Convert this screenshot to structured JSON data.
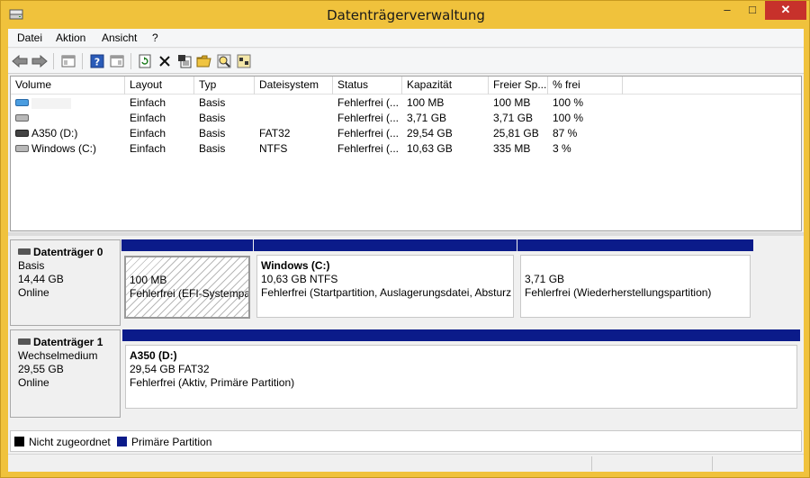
{
  "window": {
    "title": "Datenträgerverwaltung",
    "minimize": "–",
    "maximize": "□",
    "close": "✕"
  },
  "menu": [
    "Datei",
    "Aktion",
    "Ansicht",
    "?"
  ],
  "toolbar": [
    "back-arrow",
    "forward-arrow",
    "console-tree",
    "help",
    "properties-view",
    "refresh",
    "delete",
    "properties",
    "open",
    "explore",
    "rescan"
  ],
  "columns": [
    "Volume",
    "Layout",
    "Typ",
    "Dateisystem",
    "Status",
    "Kapazität",
    "Freier Sp...",
    "% frei"
  ],
  "volumes": [
    {
      "name": "",
      "layout": "Einfach",
      "type": "Basis",
      "fs": "",
      "status": "Fehlerfrei (...",
      "capacity": "100 MB",
      "free": "100 MB",
      "pct": "100 %",
      "icon": "volume-blue"
    },
    {
      "name": "",
      "layout": "Einfach",
      "type": "Basis",
      "fs": "",
      "status": "Fehlerfrei (...",
      "capacity": "3,71 GB",
      "free": "3,71 GB",
      "pct": "100 %",
      "icon": "volume-gray"
    },
    {
      "name": "A350 (D:)",
      "layout": "Einfach",
      "type": "Basis",
      "fs": "FAT32",
      "status": "Fehlerfrei (...",
      "capacity": "29,54 GB",
      "free": "25,81 GB",
      "pct": "87 %",
      "icon": "volume-dark"
    },
    {
      "name": "Windows (C:)",
      "layout": "Einfach",
      "type": "Basis",
      "fs": "NTFS",
      "status": "Fehlerfrei (...",
      "capacity": "10,63 GB",
      "free": "335 MB",
      "pct": "3 %",
      "icon": "volume-gray"
    }
  ],
  "disks": [
    {
      "name": "Datenträger 0",
      "type": "Basis",
      "size": "14,44 GB",
      "state": "Online",
      "partitions": [
        {
          "title": "",
          "size": "100 MB",
          "status": "Fehlerfrei (EFI-Systempar"
        },
        {
          "title": "Windows  (C:)",
          "size": "10,63 GB NTFS",
          "status": "Fehlerfrei (Startpartition, Auslagerungsdatei, Absturz"
        },
        {
          "title": "",
          "size": "3,71 GB",
          "status": "Fehlerfrei (Wiederherstellungspartition)"
        }
      ]
    },
    {
      "name": "Datenträger 1",
      "type": "Wechselmedium",
      "size": "29,55 GB",
      "state": "Online",
      "partitions": [
        {
          "title": "A350  (D:)",
          "size": "29,54 GB FAT32",
          "status": "Fehlerfrei (Aktiv, Primäre Partition)"
        }
      ]
    }
  ],
  "legend": [
    {
      "label": "Nicht zugeordnet",
      "color": "#000000"
    },
    {
      "label": "Primäre Partition",
      "color": "#0b1b8a"
    }
  ],
  "colors": {
    "titlebar": "#f0c23c",
    "partition_bar": "#0b1b8a",
    "close_button": "#c7312b"
  }
}
